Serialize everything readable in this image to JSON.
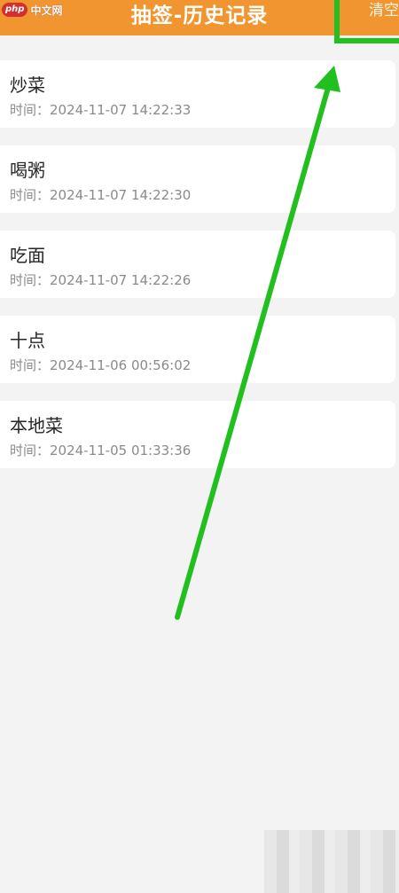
{
  "watermark": {
    "logo": "php",
    "text": "中文网"
  },
  "header": {
    "title": "抽签-历史记录",
    "clear_label": "清空"
  },
  "records": [
    {
      "name": "炒菜",
      "time": "时间：2024-11-07 14:22:33"
    },
    {
      "name": "喝粥",
      "time": "时间：2024-11-07 14:22:30"
    },
    {
      "name": "吃面",
      "time": "时间：2024-11-07 14:22:26"
    },
    {
      "name": "十点",
      "time": "时间：2024-11-06 00:56:02"
    },
    {
      "name": "本地菜",
      "time": "时间：2024-11-05 01:33:36"
    }
  ],
  "colors": {
    "header_bg": "#f0952f",
    "annotation_green": "#22c01e"
  }
}
